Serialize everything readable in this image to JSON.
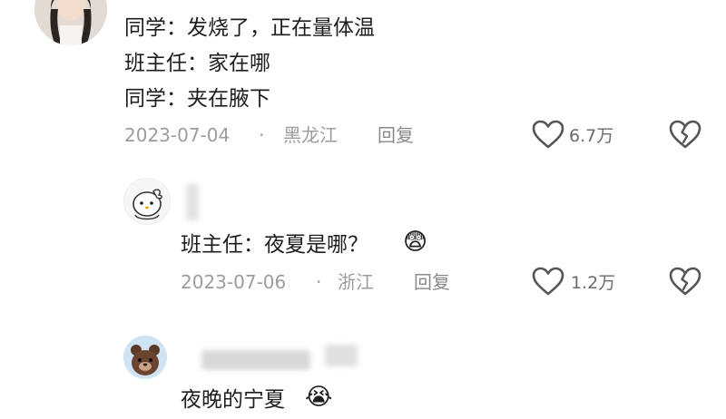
{
  "comments": [
    {
      "lines": [
        "同学：发烧了，正在量体温",
        "班主任：家在哪",
        "同学：夹在腋下"
      ],
      "date": "2023-07-04",
      "separator": "·",
      "location": "黑龙江",
      "reply": "回复",
      "likes": "6.7万"
    },
    {
      "text": "班主任：夜夏是哪？",
      "emoji": "😨",
      "date": "2023-07-06",
      "separator": "·",
      "location": "浙江",
      "reply": "回复",
      "likes": "1.2万"
    },
    {
      "text": "夜晚的宁夏",
      "emoji": "😭"
    }
  ],
  "icons": {
    "like": "heart-outline-icon",
    "dislike": "broken-heart-icon"
  },
  "colors": {
    "text": "#1e1e1e",
    "meta": "#9c9c9c",
    "icon": "#555555"
  }
}
